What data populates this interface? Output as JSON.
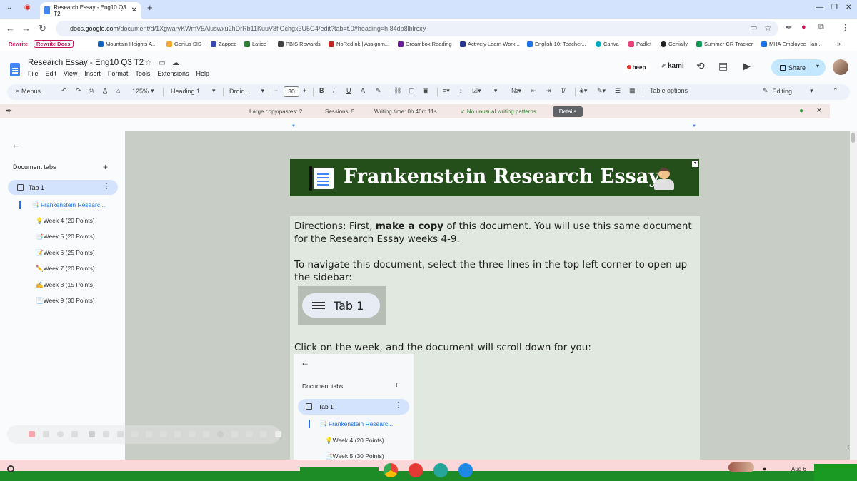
{
  "browser": {
    "tab_title": "Research Essay - Eng10 Q3 T2",
    "url_host": "docs.google.com",
    "url_path": "/document/d/1XgwarvKWmV5Aluswxu2hDrRb11KuuV8flGchgx3U5G4/edit?tab=t.0#heading=h.84db8lblrcxy",
    "bookmarks": [
      "Rewrite",
      "Rewrite Docs",
      "Mountain Heights A...",
      "Genius SIS",
      "Zappee",
      "Latice",
      "PBIS Rewards",
      "NoRedInk | Assignm...",
      "Dreambox Reading",
      "Actively Learn Work...",
      "English 10: Teacher...",
      "Canva",
      "Padlet",
      "Genially",
      "Summer CR Tracker",
      "MHA Employee Han..."
    ]
  },
  "docs": {
    "title": "Research Essay - Eng10 Q3 T2",
    "menu": [
      "File",
      "Edit",
      "View",
      "Insert",
      "Format",
      "Tools",
      "Extensions",
      "Help"
    ],
    "beep_label": "beep",
    "kami_label": "kami",
    "share_label": "Share"
  },
  "toolbar": {
    "menus_label": "Menus",
    "zoom": "125%",
    "style": "Heading 1",
    "font": "Droid ...",
    "font_size": "30",
    "table_options": "Table options",
    "mode": "Editing"
  },
  "extension": {
    "copy_pastes": "Large copy/pastes: 2",
    "sessions": "Sessions: 5",
    "writing_time": "Writing time: 0h 40m 11s",
    "pattern": "✓ No unusual writing patterns",
    "details_label": "Details"
  },
  "sidebar": {
    "heading": "Document tabs",
    "tab_label": "Tab 1",
    "items": [
      "📑 Frankenstein Researc...",
      "💡Week 4 (20 Points)",
      "📑Week 5 (20 Points)",
      "📝Week 6 (25 Points)",
      "✏️Week 7 (20 Points)",
      "✍️Week 8 (15 Points)",
      "📃Week 9 (30 Points)"
    ]
  },
  "document": {
    "banner_title": "Frankenstein Research Essay",
    "para1_a": "Directions: First, ",
    "para1_b": "make a copy",
    "para1_c": " of this document. You will use this same document for the Research Essay weeks 4-9.",
    "para2": "To navigate this document, select the three lines in the top left corner to open up the sidebar:",
    "tab_img_label": "Tab 1",
    "para3": "Click on the week, and the document will scroll down for you:",
    "nav_img": {
      "heading": "Document tabs",
      "tab_label": "Tab 1",
      "items": [
        "📑 Frankenstein Researc...",
        "💡Week 4 (20 Points)",
        "📑Week 5 (30 Points)"
      ]
    }
  },
  "taskbar": {
    "date": "Aug 6"
  },
  "colors": {
    "banner_bg": "#244e1a",
    "accent_blue": "#1a73e8",
    "share_bg": "#c2e7ff",
    "taskbar_green": "#1e8c26"
  }
}
